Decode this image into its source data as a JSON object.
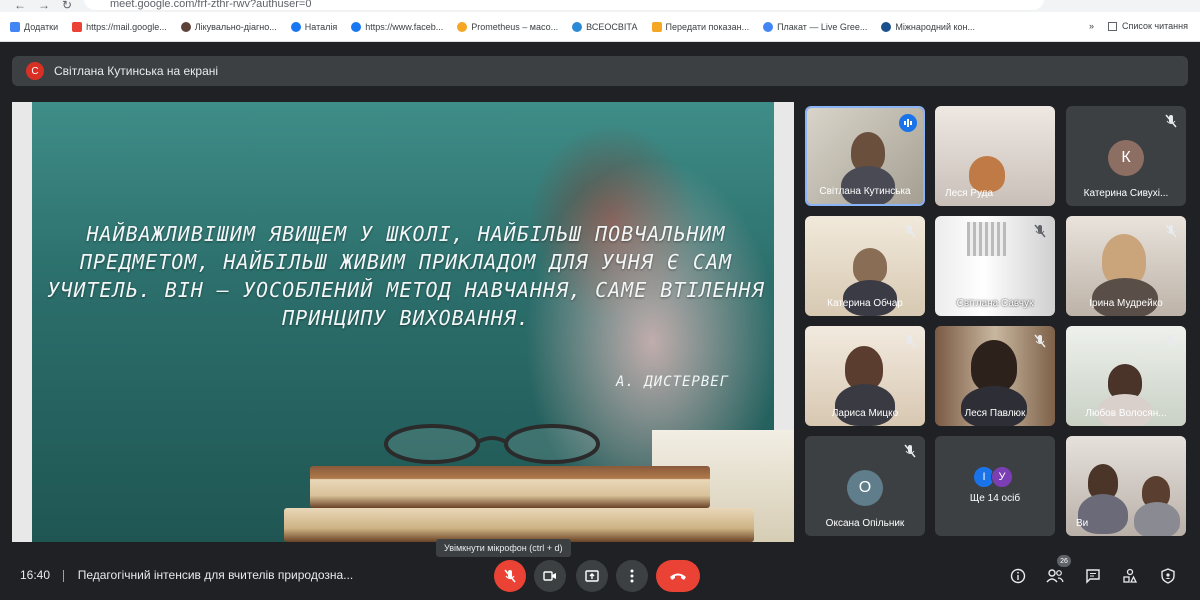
{
  "browser": {
    "url": "meet.google.com/frf-zthr-rwv?authuser=0",
    "reading_list": "Список читання",
    "bookmarks": [
      {
        "label": "Додатки",
        "color": "#4285f4"
      },
      {
        "label": "https://mail.google...",
        "color": "#ea4335"
      },
      {
        "label": "Лікувально-діагно...",
        "color": "#5d4037"
      },
      {
        "label": "Наталія",
        "color": "#1877f2"
      },
      {
        "label": "https://www.faceb...",
        "color": "#1877f2"
      },
      {
        "label": "Prometheus – масо...",
        "color": "#f5a623"
      },
      {
        "label": "ВСЕОСВІТА",
        "color": "#2b8ad8"
      },
      {
        "label": "Передати показан...",
        "color": "#f5a623"
      },
      {
        "label": "Плакат — Live Gree...",
        "color": "#4285f4"
      },
      {
        "label": "Міжнародний кон...",
        "color": "#1a4f8b"
      }
    ]
  },
  "banner": {
    "avatar": "С",
    "text": "Світлана Кутинська на екрані"
  },
  "slide": {
    "quote": "НАЙВАЖЛИВІШИМ ЯВИЩЕМ У ШКОЛІ, НАЙБІЛЬШ ПОВЧАЛЬНИМ ПРЕДМЕТОМ, НАЙБІЛЬШ ЖИВИМ ПРИКЛАДОМ ДЛЯ УЧНЯ Є САМ УЧИТЕЛЬ. ВІН – УОСОБЛЕНИЙ МЕТОД НАВЧАННЯ, САМЕ ВТІЛЕННЯ ПРИНЦИПУ ВИХОВАННЯ.",
    "author": "А. ДИСТЕРВЕГ"
  },
  "participants": [
    {
      "name": "Світлана Кутинська",
      "type": "video",
      "speaking": true
    },
    {
      "name": "Леся Руда",
      "type": "video"
    },
    {
      "name": "Катерина Сивухі...",
      "type": "avatar",
      "initial": "К",
      "color": "#8d6e63"
    },
    {
      "name": "Катерина Обчар",
      "type": "video"
    },
    {
      "name": "Світлана Савчук",
      "type": "video"
    },
    {
      "name": "Ірина Мудрейко",
      "type": "video"
    },
    {
      "name": "Лариса Мицко",
      "type": "video"
    },
    {
      "name": "Леся Павлюк",
      "type": "video"
    },
    {
      "name": "Любов Волосян...",
      "type": "video"
    },
    {
      "name": "Оксана Опільник",
      "type": "avatar",
      "initial": "О",
      "color": "#607d8b"
    },
    {
      "name": "Ще 14 осіб",
      "type": "more",
      "initials": [
        "І",
        "У"
      ],
      "colors": [
        "#1a73e8",
        "#7b3fb3"
      ]
    },
    {
      "name": "Ви",
      "type": "video"
    }
  ],
  "bottom": {
    "time": "16:40",
    "meeting_title": "Педагогічний інтенсив для вчителів природозна...",
    "tooltip": "Увімкнути мікрофон (ctrl + d)",
    "people_count": "26"
  },
  "colors": {
    "accent": "#8ab4f8",
    "danger": "#ea4335",
    "surface": "#3c4043",
    "background": "#202124"
  }
}
